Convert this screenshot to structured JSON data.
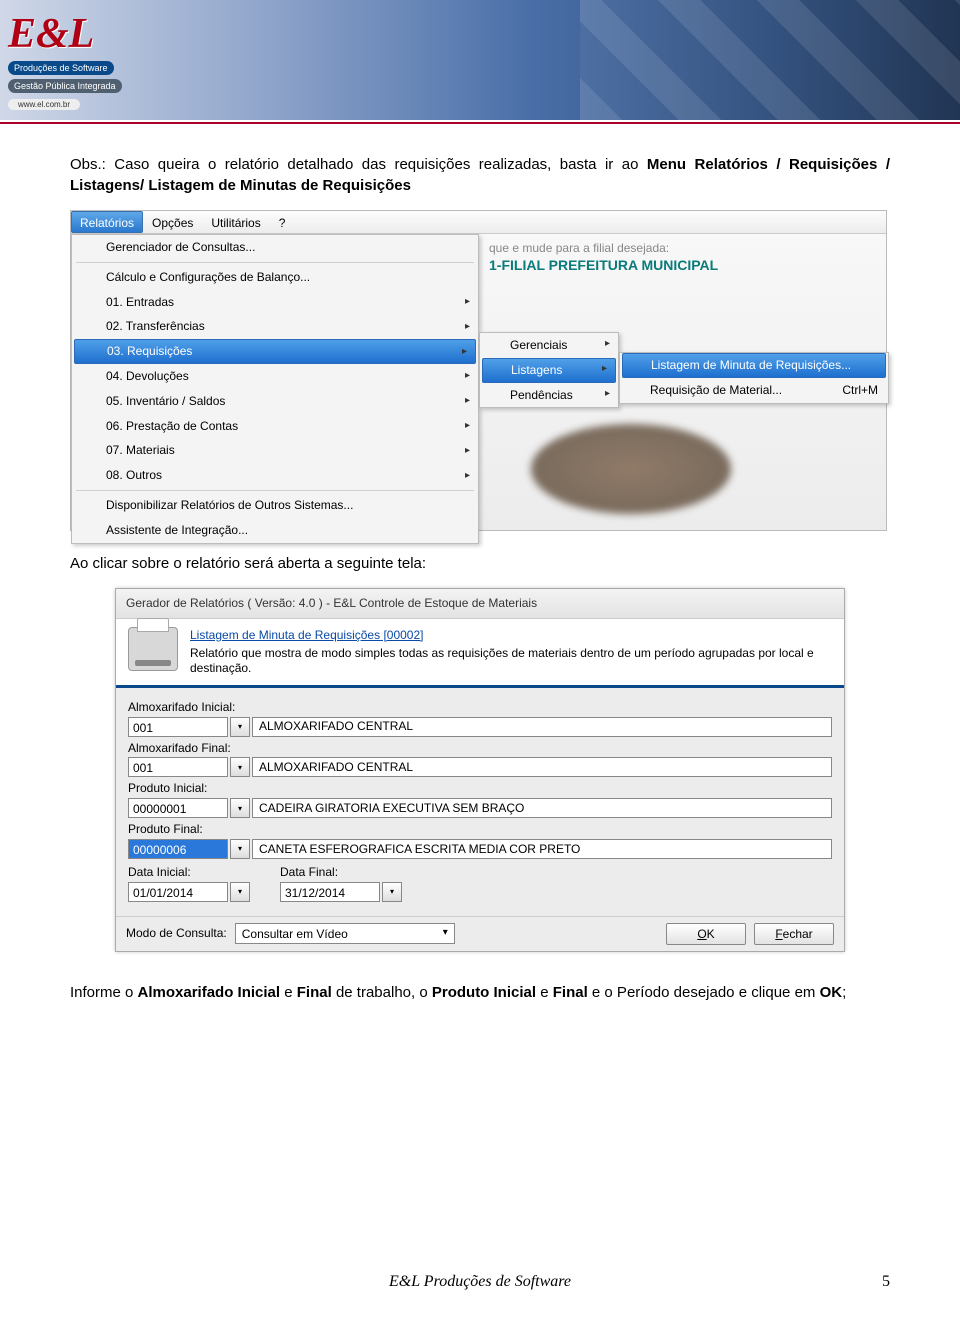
{
  "logo": {
    "brand": "E&L",
    "tag1": "Produções de Software",
    "tag2": "Gestão Pública Integrada",
    "url": "www.el.com.br"
  },
  "paragraph1_prefix": "Obs.: Caso queira o relatório detalhado das requisições realizadas, basta ir ao ",
  "paragraph1_bold": "Menu Relatórios / Requisições / Listagens/ Listagem de Minutas de Requisições",
  "menubar": {
    "relatorios": "Relatórios",
    "opcoes": "Opções",
    "utilitarios": "Utilitários",
    "help": "?"
  },
  "bg_hint": "que e mude para a filial desejada:",
  "bg_title": "1-FILIAL PREFEITURA MUNICIPAL",
  "dropdown": {
    "gerenciador": "Gerenciador de Consultas...",
    "calculo": "Cálculo e Configurações de Balanço...",
    "i01": "01. Entradas",
    "i02": "02. Transferências",
    "i03": "03. Requisições",
    "i04": "04. Devoluções",
    "i05": "05. Inventário / Saldos",
    "i06": "06. Prestação de Contas",
    "i07": "07. Materiais",
    "i08": "08. Outros",
    "disp": "Disponibilizar Relatórios de Outros Sistemas...",
    "assist": "Assistente de Integração..."
  },
  "submenu1": {
    "gerenciais": "Gerenciais",
    "listagens": "Listagens",
    "pendencias": "Pendências"
  },
  "submenu2": {
    "listagem_minuta": "Listagem de Minuta de Requisições...",
    "req_material": "Requisição de Material...",
    "shortcut": "Ctrl+M"
  },
  "paragraph2": "Ao clicar sobre o relatório será aberta a seguinte tela:",
  "dialog": {
    "title": "Gerador de Relatórios ( Versão: 4.0 ) - E&L Controle de Estoque de Materiais",
    "link": "Listagem de Minuta de Requisições [00002]",
    "desc": "Relatório que mostra de modo simples todas as requisições de materiais dentro de um período agrupadas por local e destinação.",
    "almox_ini_label": "Almoxarifado Inicial:",
    "almox_ini_code": "001",
    "almox_ini_name": "ALMOXARIFADO CENTRAL",
    "almox_fin_label": "Almoxarifado Final:",
    "almox_fin_code": "001",
    "almox_fin_name": "ALMOXARIFADO CENTRAL",
    "prod_ini_label": "Produto Inicial:",
    "prod_ini_code": "00000001",
    "prod_ini_name": "CADEIRA GIRATORIA EXECUTIVA SEM BRAÇO",
    "prod_fin_label": "Produto Final:",
    "prod_fin_code": "00000006",
    "prod_fin_name": "CANETA ESFEROGRAFICA ESCRITA MEDIA COR PRETO",
    "data_ini_label": "Data Inicial:",
    "data_ini_val": "01/01/2014",
    "data_fin_label": "Data Final:",
    "data_fin_val": "31/12/2014",
    "modo_label": "Modo de Consulta:",
    "modo_val": "Consultar em Vídeo",
    "ok": "OK",
    "fechar": "Fechar"
  },
  "paragraph3_a": "Informe o ",
  "paragraph3_b": "Almoxarifado Inicial",
  "paragraph3_c": " e ",
  "paragraph3_d": "Final",
  "paragraph3_e": " de trabalho, o ",
  "paragraph3_f": "Produto Inicial",
  "paragraph3_g": " e ",
  "paragraph3_h": "Final",
  "paragraph3_i": " e o Período desejado e clique em ",
  "paragraph3_j": "OK",
  "paragraph3_k": ";",
  "footer": "E&L Produções de Software",
  "page": "5"
}
